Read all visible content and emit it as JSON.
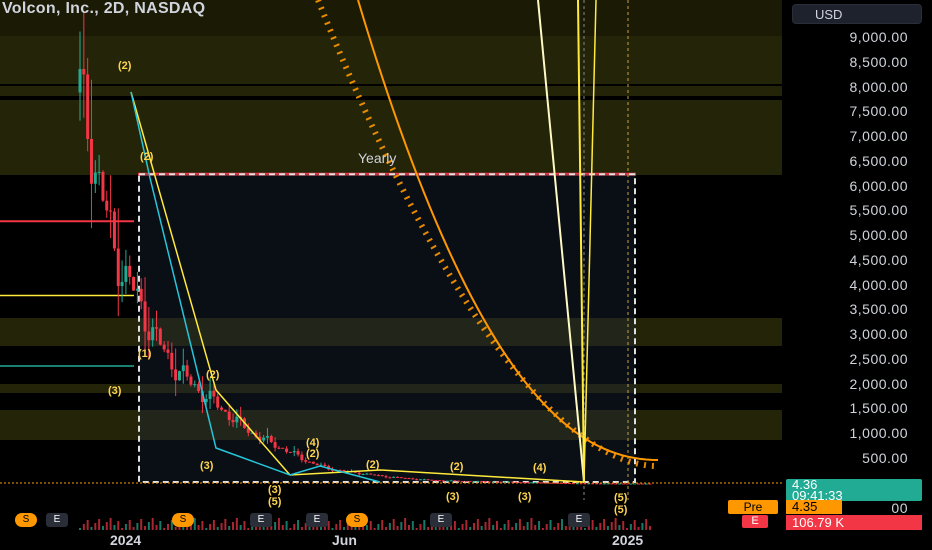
{
  "header": {
    "title": "Volcon, Inc., 2D, NASDAQ",
    "currency_label": "USD"
  },
  "price_scale": {
    "ticks": [
      "9,000.00",
      "8,500.00",
      "8,000.00",
      "7,500.00",
      "7,000.00",
      "6,500.00",
      "6,000.00",
      "5,500.00",
      "5,000.00",
      "4,500.00",
      "4,000.00",
      "3,500.00",
      "3,000.00",
      "2,500.00",
      "2,000.00",
      "1,500.00",
      "1,000.00",
      "500.00",
      "00"
    ]
  },
  "last_price": {
    "value": "4.36",
    "countdown": "09:41:33",
    "color": "#22ab94"
  },
  "premarket": {
    "label": "Pre",
    "value": "4.35",
    "color": "#ff9800"
  },
  "earnings_tag": {
    "label": "E",
    "color": "#f23645"
  },
  "volume_tag": {
    "value": "106.79 K",
    "color": "#f23645"
  },
  "time_axis": {
    "labels": [
      "2024",
      "Jun",
      "2025"
    ]
  },
  "annotations": {
    "yearly_label": "Yearly",
    "waves": [
      "(2)",
      "(2)",
      "(1)",
      "(3)",
      "(2)",
      "(3)",
      "(4)",
      "(2)",
      "(3)",
      "(5)",
      "(2)",
      "(2)",
      "(3)",
      "(3)",
      "(4)",
      "(5)",
      "(5)"
    ]
  },
  "events": [
    "S",
    "E",
    "S",
    "E",
    "E",
    "S",
    "E",
    "E"
  ],
  "colors": {
    "up": "#22ab94",
    "down": "#f23645",
    "orange": "#ff9800",
    "yellow": "#ffeb3b",
    "red_line": "#f23645",
    "zone": "#2a2a0a"
  },
  "chart_data": {
    "type": "line",
    "title": "Volcon, Inc., 2D, NASDAQ",
    "xlabel": "",
    "ylabel": "",
    "x_tick_labels": [
      "2024",
      "Jun",
      "2025"
    ],
    "ylim": [
      0,
      9200
    ],
    "y_ticks": [
      500,
      1000,
      1500,
      2000,
      2500,
      3000,
      3500,
      4000,
      4500,
      5000,
      5500,
      6000,
      6500,
      7000,
      7500,
      8000,
      8500,
      9000
    ],
    "series": [
      {
        "values": [
          7900,
          6200,
          4600,
          3900,
          3100,
          2500,
          2100,
          1800,
          1500,
          1200,
          950,
          780,
          600,
          420,
          300,
          250,
          200,
          150,
          120,
          90,
          70,
          60,
          50,
          45,
          40,
          30,
          25,
          15,
          10,
          8,
          6,
          5,
          4.36
        ]
      }
    ],
    "horizontal_levels": [
      6250,
      5300,
      3800
    ],
    "annotation_levels": [
      500
    ]
  }
}
